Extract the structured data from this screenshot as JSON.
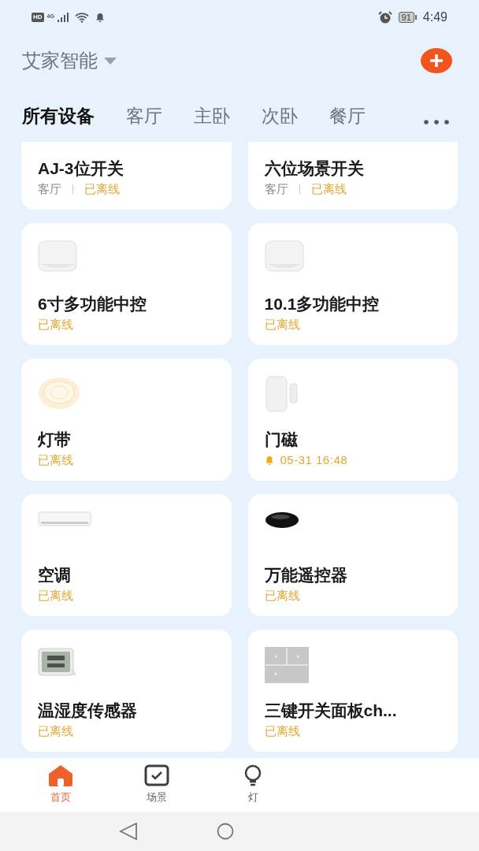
{
  "status_bar": {
    "badge": "HD",
    "network": "4G",
    "battery": "91",
    "time": "4:49"
  },
  "header": {
    "home_name": "艾家智能"
  },
  "room_tabs": [
    {
      "label": "所有设备",
      "selected": true
    },
    {
      "label": "客厅",
      "selected": false
    },
    {
      "label": "主卧",
      "selected": false
    },
    {
      "label": "次卧",
      "selected": false
    },
    {
      "label": "餐厅",
      "selected": false
    }
  ],
  "devices": [
    {
      "name": "AJ-3位开关",
      "room": "客厅",
      "status": "已离线"
    },
    {
      "name": "六位场景开关",
      "room": "客厅",
      "status": "已离线"
    },
    {
      "kind": "hub",
      "name": "6寸多功能中控",
      "status": "已离线"
    },
    {
      "kind": "hub",
      "name": "10.1多功能中控",
      "status": "已离线"
    },
    {
      "kind": "lightstrip",
      "name": "灯带",
      "status": "已离线"
    },
    {
      "kind": "doorsensor",
      "name": "门磁",
      "alarm_time": "05-31 16:48"
    },
    {
      "kind": "aircon",
      "name": "空调",
      "status": "已离线"
    },
    {
      "kind": "remote",
      "name": "万能遥控器",
      "status": "已离线"
    },
    {
      "kind": "thermometer",
      "name": "温湿度传感器",
      "status": "已离线"
    },
    {
      "kind": "switchpanel",
      "name": "三键开关面板ch...",
      "status": "已离线"
    }
  ],
  "bottom_tabs": [
    {
      "kind": "home",
      "label": "首页",
      "selected": true
    },
    {
      "kind": "scene",
      "label": "场景",
      "selected": false
    },
    {
      "kind": "light",
      "label": "灯",
      "selected": false
    }
  ]
}
